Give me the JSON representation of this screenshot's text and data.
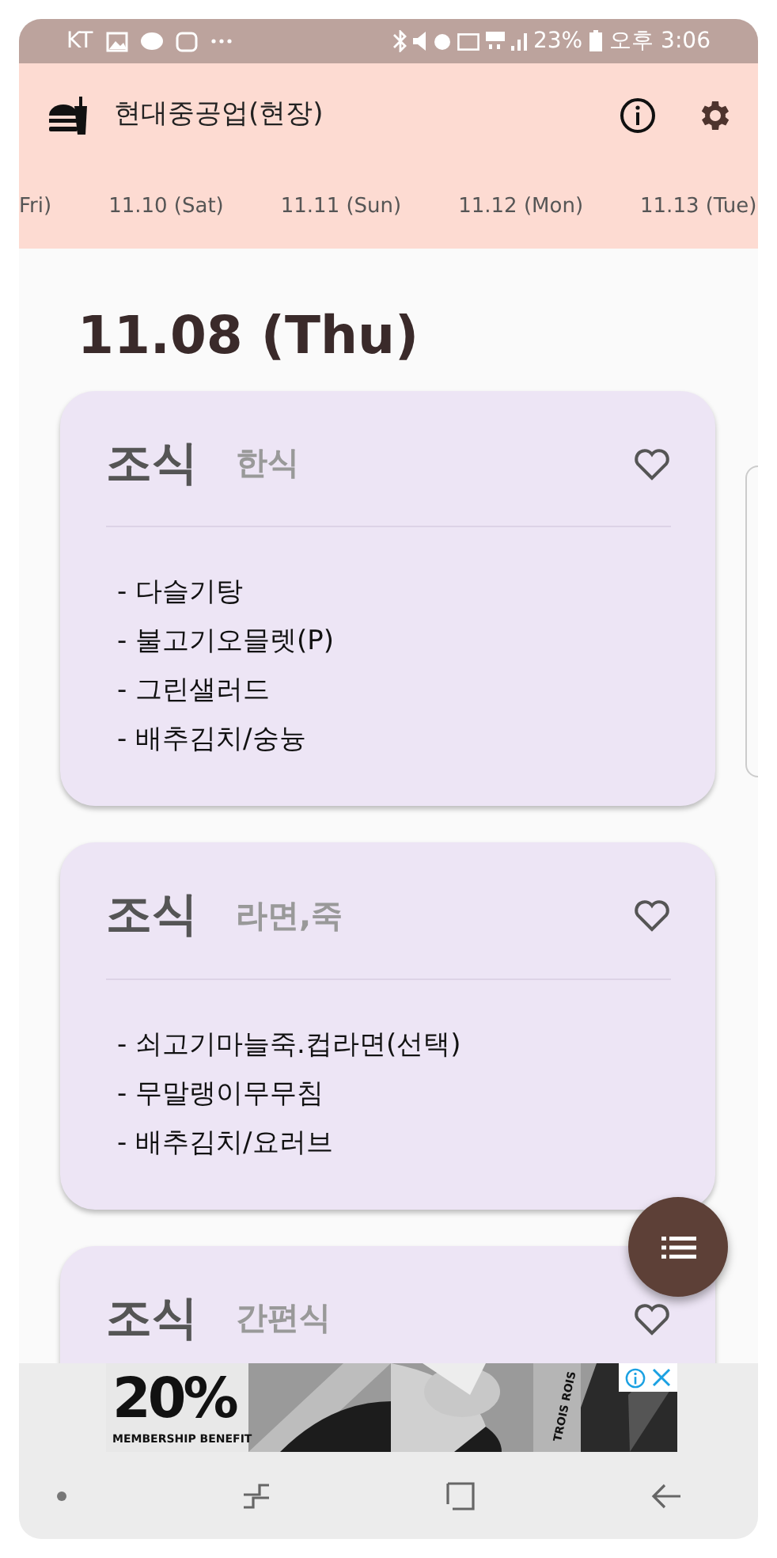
{
  "status_bar": {
    "carrier": "KT",
    "battery": "23%",
    "time": "오후 3:06"
  },
  "app_bar": {
    "title": "현대중공업(현장)"
  },
  "date_tabs": [
    "Fri)",
    "11.10 (Sat)",
    "11.11 (Sun)",
    "11.12 (Mon)",
    "11.13 (Tue)"
  ],
  "date_heading": "11.08 (Thu)",
  "meals": [
    {
      "title": "조식",
      "category": "한식",
      "favorite": false,
      "items": [
        "- 다슬기탕",
        "- 불고기오믈렛(P)",
        "- 그린샐러드",
        "- 배추김치/숭늉"
      ]
    },
    {
      "title": "조식",
      "category": "라면,죽",
      "favorite": false,
      "items": [
        "- 쇠고기마늘죽.컵라면(선택)",
        "- 무말랭이무무침",
        "- 배추김치/요러브"
      ]
    },
    {
      "title": "조식",
      "category": "간편식",
      "favorite": false
    }
  ],
  "ad": {
    "headline": "20%",
    "subline": "MEMBERSHIP BENEFIT",
    "brand": "TROIS ROIS"
  }
}
